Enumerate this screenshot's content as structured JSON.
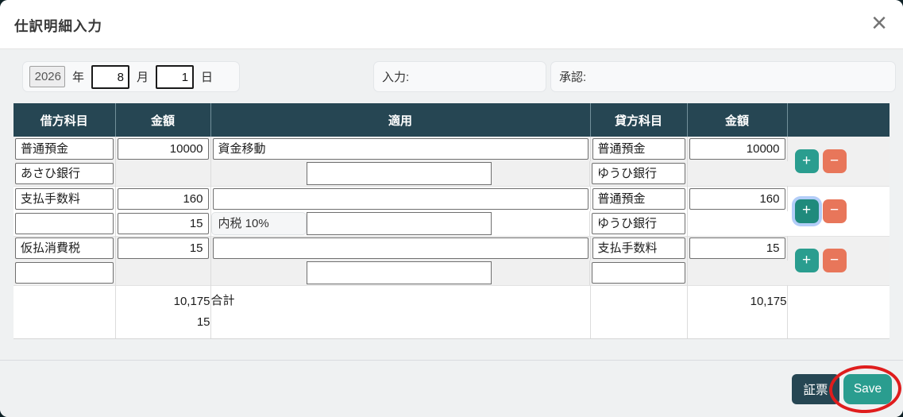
{
  "dialog": {
    "title": "仕訳明細入力",
    "close_icon": "×"
  },
  "date_row": {
    "year_value": "2026",
    "year_label": "年",
    "month_value": "8",
    "month_label": "月",
    "day_value": "1",
    "day_label": "日",
    "input_label": "入力:",
    "approval_label": "承認:"
  },
  "table": {
    "headers": {
      "debit_account": "借方科目",
      "debit_amount": "金額",
      "memo": "適用",
      "credit_account": "貸方科目",
      "credit_amount": "金額",
      "actions": ""
    },
    "groups": [
      {
        "row1": {
          "debit_account": "普通預金",
          "debit_amount": "10000",
          "memo": "資金移動",
          "credit_account": "普通預金",
          "credit_amount": "10000"
        },
        "row2": {
          "debit_sub_account": "あさひ銀行",
          "memo_input": "",
          "credit_sub_account": "ゆうひ銀行"
        }
      },
      {
        "row1": {
          "debit_account": "支払手数料",
          "debit_amount": "160",
          "memo": "",
          "credit_account": "普通預金",
          "credit_amount": "160"
        },
        "row2": {
          "debit_sub_account": "",
          "debit_amount": "15",
          "tax_label": "内税 10%",
          "memo_input": "",
          "credit_sub_account": "ゆうひ銀行"
        }
      },
      {
        "row1": {
          "debit_account": "仮払消費税",
          "debit_amount": "15",
          "memo": "",
          "credit_account": "支払手数料",
          "credit_amount": "15"
        },
        "row2": {
          "debit_sub_account": "",
          "memo_input": "",
          "credit_sub_account": ""
        }
      }
    ],
    "totals": {
      "debit_total": "10,175",
      "debit_tax_total": "15",
      "label": "合計",
      "credit_total": "10,175"
    },
    "buttons": {
      "add_label": "+",
      "remove_label": "−"
    }
  },
  "footer": {
    "voucher_label": "証票",
    "save_label": "Save"
  },
  "colors": {
    "header_bg": "#264653",
    "add_button": "#2a9d8f",
    "remove_button": "#e8765a",
    "save_button": "#2a9d8f",
    "annotation_circle": "#df1d1d"
  }
}
